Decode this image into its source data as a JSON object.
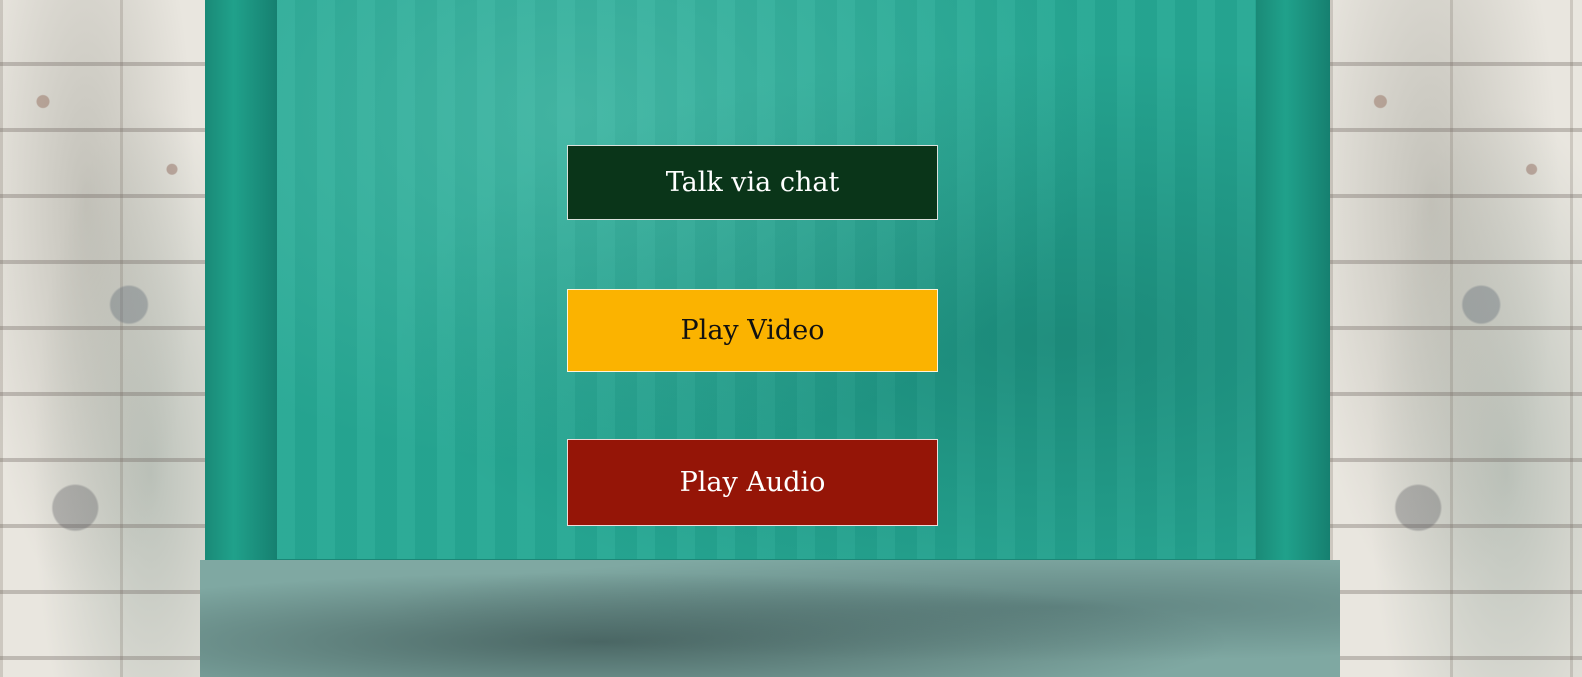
{
  "buttons": {
    "chat": {
      "label": "Talk via chat",
      "background": "#0a3519",
      "color": "#ffffff"
    },
    "video": {
      "label": "Play Video",
      "background": "#fbb300",
      "color": "#111111"
    },
    "audio": {
      "label": "Play Audio",
      "background": "#951507",
      "color": "#ffffff"
    }
  },
  "colors": {
    "door": "#26a894",
    "wall": "#e9e6df"
  }
}
